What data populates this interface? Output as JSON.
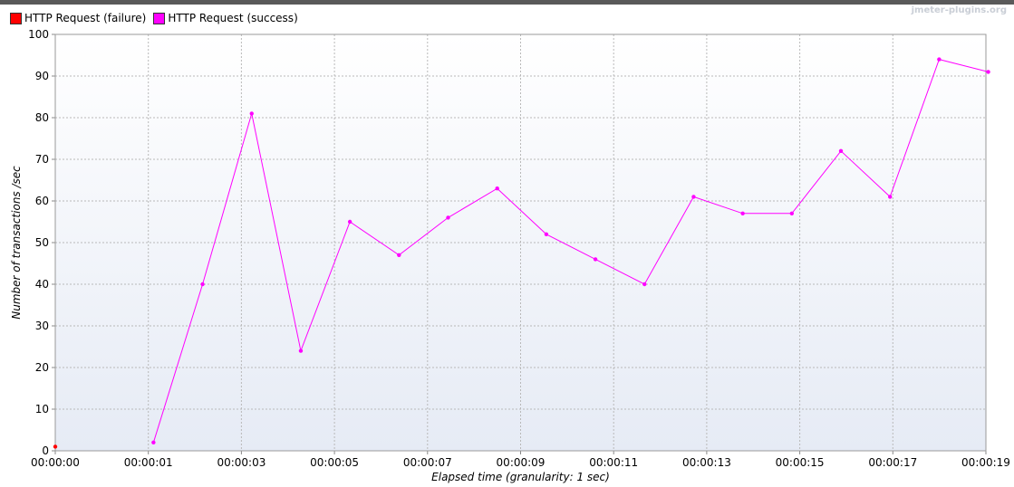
{
  "watermark": "jmeter-plugins.org",
  "chart_data": {
    "type": "line",
    "title": "",
    "xlabel": "Elapsed time (granularity: 1 sec)",
    "ylabel": "Number of transactions /sec",
    "ylim": [
      0,
      100
    ],
    "yticks": [
      0,
      10,
      20,
      30,
      40,
      50,
      60,
      70,
      80,
      90,
      100
    ],
    "xlim_seconds": [
      0,
      19.9
    ],
    "xtick_labels": [
      "00:00:00",
      "00:00:01",
      "00:00:03",
      "00:00:05",
      "00:00:07",
      "00:00:09",
      "00:00:11",
      "00:00:13",
      "00:00:15",
      "00:00:17",
      "00:00:19"
    ],
    "grid": true,
    "legend_position": "top-left",
    "series": [
      {
        "name": "HTTP Request (failure)",
        "color": "#ff0000",
        "x_seconds": [
          0
        ],
        "values": [
          1
        ]
      },
      {
        "name": "HTTP Request (success)",
        "color": "#ff00ff",
        "x_seconds": [
          2.1,
          3.15,
          4.2,
          5.25,
          6.3,
          7.35,
          8.4,
          9.45,
          10.5,
          11.55,
          12.6,
          13.65,
          14.7,
          15.75,
          16.8,
          17.85,
          18.9,
          19.95
        ],
        "values": [
          2,
          40,
          81,
          24,
          55,
          47,
          56,
          63,
          52,
          46,
          40,
          61,
          57,
          57,
          72,
          61,
          94,
          91
        ]
      }
    ]
  }
}
